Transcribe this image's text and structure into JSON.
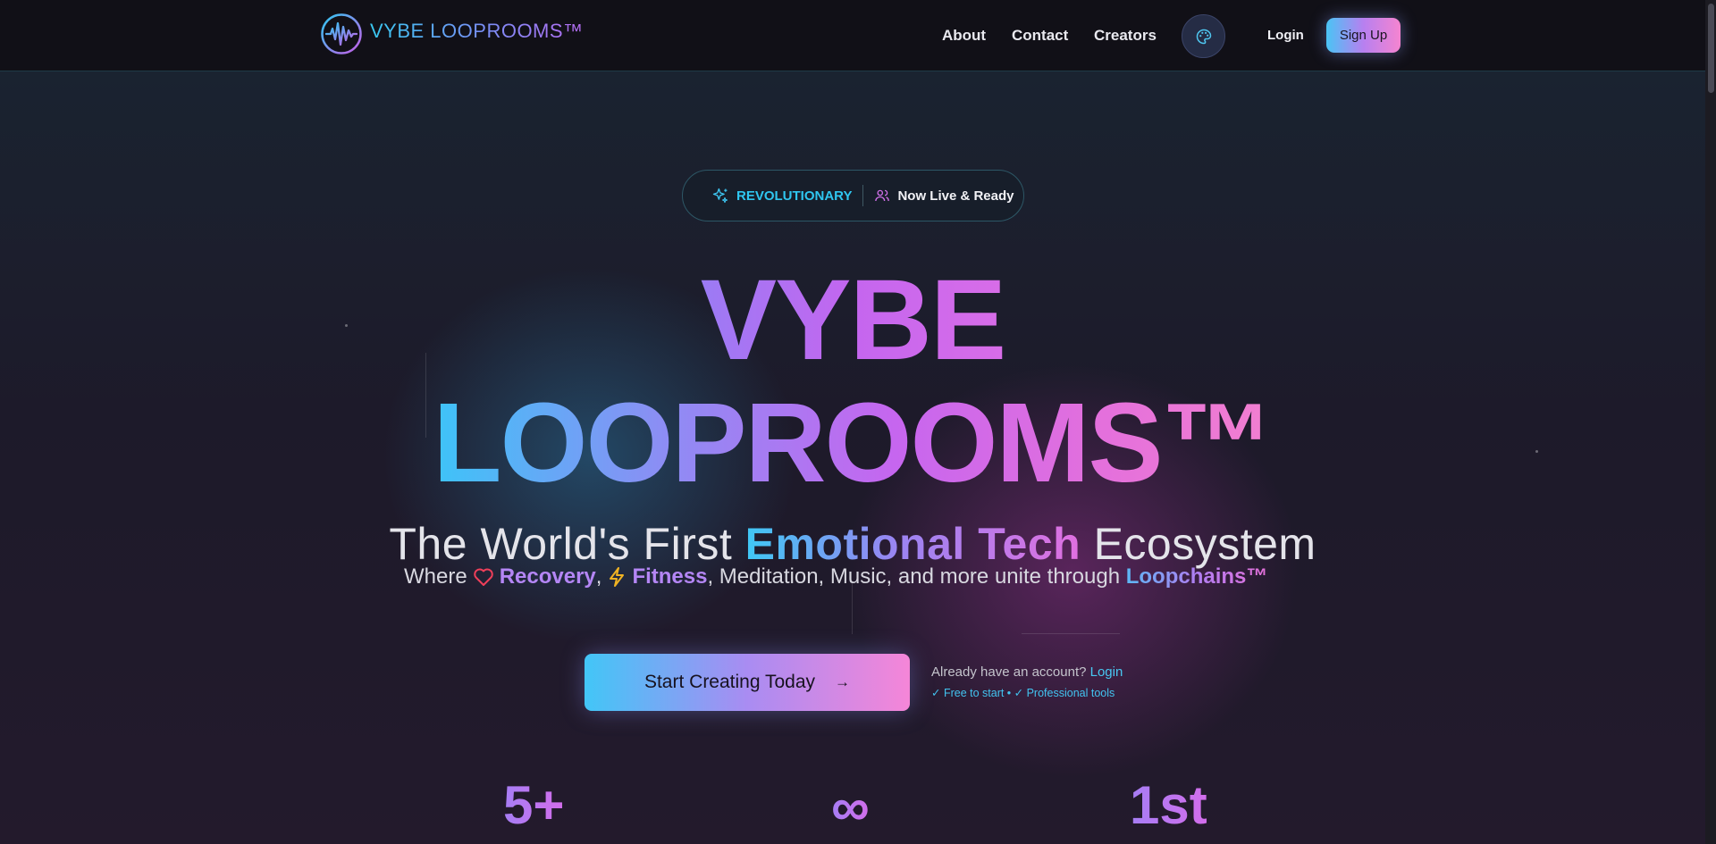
{
  "nav": {
    "brand": "VYBE LOOPROOMS™",
    "links": [
      "About",
      "Contact",
      "Creators"
    ],
    "login": "Login",
    "signup": "Sign Up",
    "icons": {
      "logo": "waveform-circle-icon",
      "theme": "palette-icon"
    }
  },
  "badge": {
    "left": "REVOLUTIONARY",
    "right": "Now Live & Ready",
    "icons": {
      "left": "sparkles-icon",
      "right": "users-icon"
    }
  },
  "hero": {
    "line1": "VYBE",
    "line2": "LOOPROOMS™",
    "tagline_pre": "The World's First ",
    "tagline_highlight": "Emotional Tech",
    "tagline_post": " Ecosystem",
    "sub_where": "Where",
    "sub_recovery": "Recovery",
    "sub_comma": ",",
    "sub_fitness": "Fitness",
    "sub_rest": ", Meditation, Music, and more unite through ",
    "sub_loopchains": "Loopchains™",
    "sub_icons": {
      "recovery": "heart-icon",
      "fitness": "lightning-icon"
    }
  },
  "cta": {
    "button": "Start Creating Today",
    "arrow": "→",
    "account_text": "Already have an account?",
    "account_link": "Login",
    "perks": "✓ Free to start • ✓ Professional tools"
  },
  "stats": [
    "5+",
    "∞",
    "1st"
  ],
  "colors": {
    "accent_cyan": "#38c8f0",
    "accent_purple": "#b66cf2",
    "accent_pink": "#f584d0",
    "background": "#17151f"
  }
}
